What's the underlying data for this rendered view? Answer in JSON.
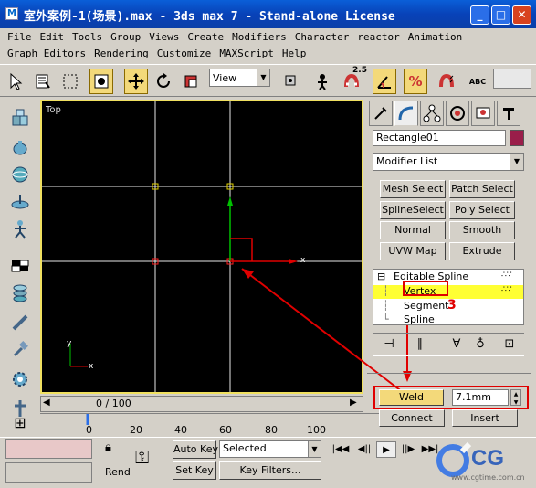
{
  "window": {
    "title": "室外案例-1(场景).max - 3ds max 7  - Stand-alone License",
    "app_icon": "3ds-max-icon"
  },
  "menu": {
    "row1": [
      "File",
      "Edit",
      "Tools",
      "Group",
      "Views",
      "Create",
      "Modifiers",
      "Character",
      "reactor",
      "Animation"
    ],
    "row2": [
      "Graph Editors",
      "Rendering",
      "Customize",
      "MAXScript",
      "Help"
    ]
  },
  "toolbar": {
    "view_select": "View",
    "angle_snap_label": "2.5",
    "percent_snap_label": "%",
    "spell_label": "ABC"
  },
  "viewport": {
    "label": "Top",
    "axis_x": "x",
    "gizmo_axis_y": "y",
    "gizmo_axis_x": "x"
  },
  "time_slider": {
    "value": "0 / 100",
    "ticks": [
      "0",
      "20",
      "40",
      "60",
      "80",
      "100"
    ]
  },
  "command_panel": {
    "object_name": "Rectangle01",
    "object_color": "#9a1e4a",
    "modifier_list": "Modifier List",
    "modifier_buttons": [
      "Mesh Select",
      "Patch Select",
      "SplineSelect",
      "Poly Select",
      "Normal",
      "Smooth",
      "UVW Map",
      "Extrude"
    ],
    "stack": {
      "root_label": "Editable Spline",
      "items": [
        "Vertex",
        "Segment",
        "Spline"
      ],
      "selected": "Vertex",
      "expander": "⊟"
    },
    "annotation_number": "3",
    "weld_label": "Weld",
    "weld_value": "7.1mm",
    "connect_label": "Connect",
    "insert_label": "Insert"
  },
  "status": {
    "autokey_label": "Auto Key",
    "setkey_label": "Set Key",
    "selected_label": "Selected",
    "key_filters_label": "Key Filters...",
    "rend_label": "Rend"
  },
  "watermark": {
    "text": "CG",
    "url": "www.cgtime.com.cn"
  },
  "colors": {
    "title_bar": "#0842b8",
    "active_button": "#f3d97a",
    "highlight_red": "#e00000",
    "selected_row": "#ffff33",
    "viewport_bg": "#000000"
  }
}
